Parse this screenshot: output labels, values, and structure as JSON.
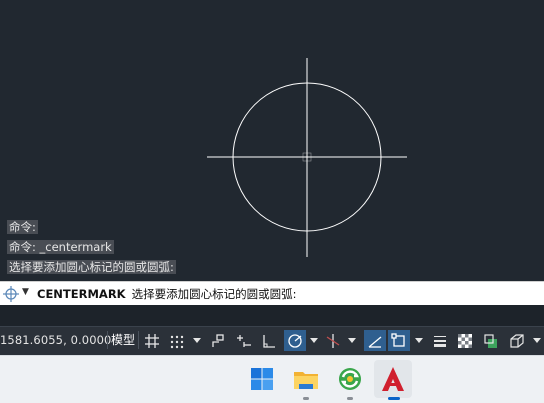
{
  "history": [
    "命令:",
    "命令: _centermark",
    "选择要添加圆心标记的圆或圆弧:"
  ],
  "command_line": {
    "keyword": "CENTERMARK",
    "prompt": "选择要添加圆心标记的圆或圆弧:"
  },
  "status_bar": {
    "coordinates": "1581.6055, 0.0000",
    "model_tab": "模型",
    "buttons": [
      "grid-icon",
      "snap-icon",
      "infer-constraints-icon",
      "dynamic-input-icon",
      "ortho-icon",
      "polar-tracking-icon",
      "isodraft-icon",
      "object-snap-tracking-icon",
      "object-snap-icon",
      "lineweight-icon",
      "transparency-icon",
      "selection-cycling-icon",
      "3d-osnap-icon"
    ]
  },
  "taskbar": {
    "apps": [
      "windows-start-icon",
      "file-explorer-icon",
      "browser-icon",
      "autocad-icon"
    ]
  },
  "colors": {
    "canvas_bg": "#212830",
    "geometry": "#ffffff",
    "active_toggle": "#2f5f8f",
    "autocad_red": "#d0202e"
  }
}
